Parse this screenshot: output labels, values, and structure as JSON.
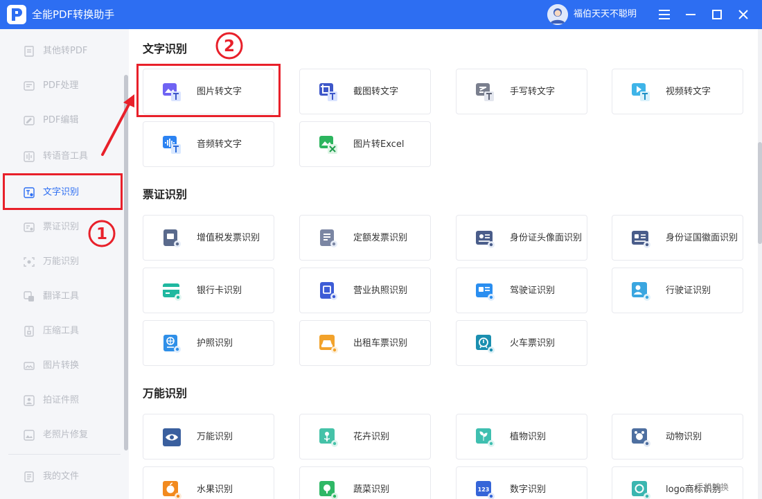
{
  "app": {
    "title": "全能PDF转换助手",
    "username": "福伯天天不聪明"
  },
  "sidebar": {
    "items": [
      {
        "label": "其他转PDF",
        "icon": "pdf-file-icon"
      },
      {
        "label": "PDF处理",
        "icon": "pdf-process-icon"
      },
      {
        "label": "PDF编辑",
        "icon": "pdf-edit-icon"
      },
      {
        "label": "转语音工具",
        "icon": "voice-icon"
      },
      {
        "label": "文字识别",
        "icon": "text-ocr-icon",
        "active": true
      },
      {
        "label": "票证识别",
        "icon": "ticket-icon"
      },
      {
        "label": "万能识别",
        "icon": "scan-icon"
      },
      {
        "label": "翻译工具",
        "icon": "translate-icon"
      },
      {
        "label": "压缩工具",
        "icon": "compress-icon"
      },
      {
        "label": "图片转换",
        "icon": "image-convert-icon"
      },
      {
        "label": "拍证件照",
        "icon": "id-photo-icon"
      },
      {
        "label": "老照片修复",
        "icon": "photo-repair-icon"
      },
      {
        "label": "我的文件",
        "icon": "my-files-icon"
      }
    ]
  },
  "sections": [
    {
      "title": "文字识别",
      "cards": [
        {
          "label": "图片转文字",
          "color": "#6f63f3"
        },
        {
          "label": "截图转文字",
          "color": "#3e57c9"
        },
        {
          "label": "手写转文字",
          "color": "#7a7f8e"
        },
        {
          "label": "视频转文字",
          "color": "#3fb4e8"
        },
        {
          "label": "音频转文字",
          "color": "#2c83f2"
        },
        {
          "label": "图片转Excel",
          "color": "#2cb55e"
        }
      ]
    },
    {
      "title": "票证识别",
      "cards": [
        {
          "label": "增值税发票识别",
          "color": "#5a6a8c"
        },
        {
          "label": "定额发票识别",
          "color": "#7b86a3"
        },
        {
          "label": "身份证头像面识别",
          "color": "#4a5d8a"
        },
        {
          "label": "身份证国徽面识别",
          "color": "#4a5d8a"
        },
        {
          "label": "银行卡识别",
          "color": "#1fb8a0"
        },
        {
          "label": "营业执照识别",
          "color": "#3d5cd6"
        },
        {
          "label": "驾驶证识别",
          "color": "#2a8ef0"
        },
        {
          "label": "行驶证识别",
          "color": "#3aa6e0"
        },
        {
          "label": "护照识别",
          "color": "#2f8fe8"
        },
        {
          "label": "出租车票识别",
          "color": "#f2a22b"
        },
        {
          "label": "火车票识别",
          "color": "#1b8fb0"
        }
      ]
    },
    {
      "title": "万能识别",
      "cards": [
        {
          "label": "万能识别",
          "color": "#3a5f9e"
        },
        {
          "label": "花卉识别",
          "color": "#45c2a8"
        },
        {
          "label": "植物识别",
          "color": "#3fbfb0"
        },
        {
          "label": "动物识别",
          "color": "#4e6fa0"
        },
        {
          "label": "水果识别",
          "color": "#f28a1e"
        },
        {
          "label": "蔬菜识别",
          "color": "#2fb866"
        },
        {
          "label": "数字识别",
          "color": "#3565d8"
        },
        {
          "label": "logo商标识别",
          "color": "#3ab6b0"
        }
      ]
    }
  ],
  "annotations": {
    "marker_1": "①",
    "marker_2": "②",
    "color": "#e8202a"
  },
  "watermark": "手机转换"
}
